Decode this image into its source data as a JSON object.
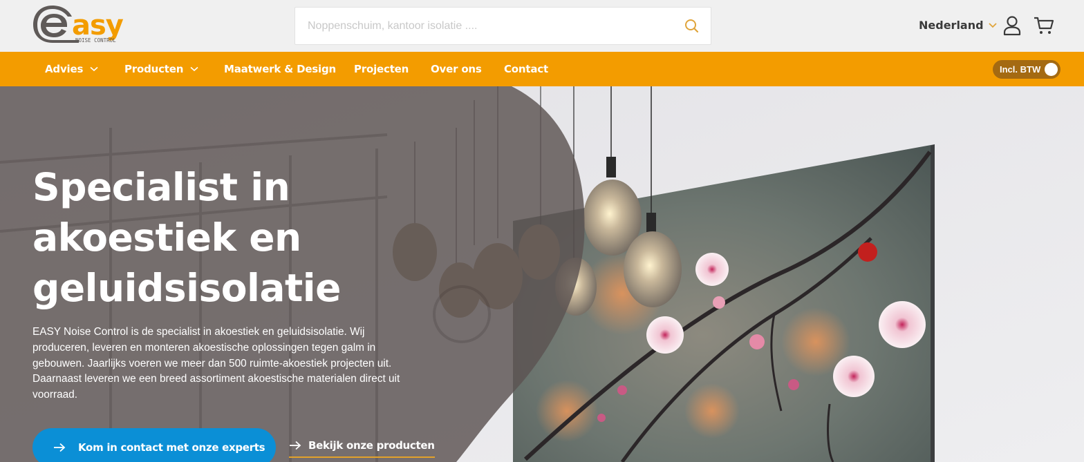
{
  "brand": {
    "logo_mark": "e",
    "logo_word": "asy",
    "logo_sub": "NOISE CONTROL",
    "colors": {
      "orange": "#f39c00",
      "grey": "#5f5a58",
      "blue": "#0b8fd6"
    }
  },
  "header": {
    "search": {
      "placeholder": "Noppenschuim, kantoor isolatie ....",
      "value": "",
      "icon": "search-icon"
    },
    "country": {
      "label": "Nederland",
      "icon": "chevron-down-icon"
    },
    "account_icon": "user-icon",
    "cart_icon": "cart-icon"
  },
  "nav": {
    "items": [
      {
        "label": "Advies",
        "has_dropdown": true
      },
      {
        "label": "Producten",
        "has_dropdown": true
      },
      {
        "label": "Maatwerk & Design",
        "has_dropdown": false
      },
      {
        "label": "Projecten",
        "has_dropdown": false
      },
      {
        "label": "Over ons",
        "has_dropdown": false
      },
      {
        "label": "Contact",
        "has_dropdown": false
      }
    ],
    "vat_toggle": {
      "label": "Incl. BTW",
      "on": true
    }
  },
  "hero": {
    "title_lines": [
      "Specialist in",
      "akoestiek en",
      "geluidsisolatie"
    ],
    "text_lines": [
      "EASY Noise Control is de specialist in akoestiek en geluidsisolatie. Wij",
      "produceren, leveren en monteren akoestische oplossingen tegen galm in",
      "gebouwen. Jaarlijks voeren we meer dan 500 ruimte-akoestiek projecten uit.",
      "Daarnaast leveren we een breed assortiment akoestische materialen direct uit",
      "voorraad."
    ],
    "cta_primary": "Kom in contact met onze experts",
    "cta_secondary": "Bekijk onze producten"
  }
}
